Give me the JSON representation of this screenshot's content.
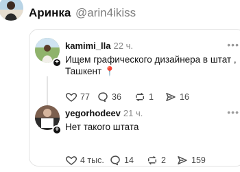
{
  "header": {
    "name": "Аринка",
    "handle": "@arin4ikiss"
  },
  "posts": [
    {
      "username": "kamimi_lla",
      "time": "22 ч.",
      "text": "Ищем графического дизайнера в штат , Ташкент 📍",
      "likes": "77",
      "replies": "36",
      "reposts": "1",
      "shares": "16"
    },
    {
      "username": "yegorhodeev",
      "time": "21 ч.",
      "text": "Нет такого штата",
      "likes": "4 тыс.",
      "replies": "14",
      "reposts": "2",
      "shares": "159"
    }
  ],
  "icons": {
    "like": "heart-icon",
    "reply": "comment-icon",
    "repost": "repost-icon",
    "share": "send-icon",
    "more": "more-dots-icon",
    "follow": "plus-icon"
  },
  "colors": {
    "text": "#111111",
    "muted": "#8a8a8a",
    "border": "#e2e2e2"
  }
}
